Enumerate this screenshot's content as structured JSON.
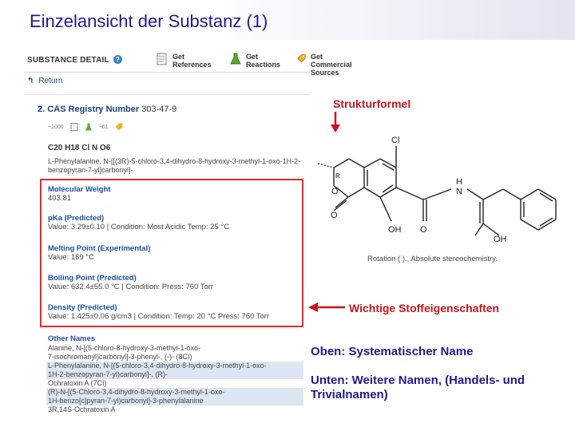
{
  "slide": {
    "title": "Einzelansicht der Substanz (1)"
  },
  "toolbar": {
    "title": "SUBSTANCE DETAIL",
    "help": "?",
    "get_references": [
      "Get",
      "References"
    ],
    "get_reactions": [
      "Get",
      "Reactions"
    ],
    "get_commercial": [
      "Get Commercial",
      "Sources"
    ]
  },
  "nav": {
    "return_label": "Return"
  },
  "substance": {
    "index": "2.",
    "reg_label": "CAS Registry Number",
    "reg_number": "303-47-9",
    "mini_1": "~1000",
    "mini_2": "~61",
    "formula": "C20 H18 Cl N O6",
    "systematic_name": "L-Phenylalanine, N-[[(3R)-5-chloro-3,4-dihydro-8-hydroxy-3-methyl-1-oxo-1H-2-benzopyran-7-yl]carbonyl]-"
  },
  "properties": [
    {
      "label": "Molecular Weight",
      "value": "403.81"
    },
    {
      "label": "pKa (Predicted)",
      "value": "Value: 3.29±0.10 | Condition: Most Acidic Temp: 25 °C"
    },
    {
      "label": "Melting Point (Experimental)",
      "value": "Value: 169 °C"
    },
    {
      "label": "Boiling Point (Predicted)",
      "value": "Value: 632.4±55.0 °C | Condition: Press: 760 Torr"
    },
    {
      "label": "Density (Predicted)",
      "value": "Value: 1.425±0.06 g/cm3 | Condition: Temp: 20 °C Press: 760 Torr"
    }
  ],
  "other_names": {
    "heading": "Other Names",
    "rows": [
      "Alanine, N-[(5-chloro-8-hydroxy-3-methyl-1-oxo-",
      "7-isochromanyl)carbonyl]-3-phenyl-, (-)- (8CI)",
      "L-Phenylalanine, N-[(5-chloro-3,4-dihydro-8-hydroxy-3-methyl-1-oxo-",
      "1H-2-benzopyran-7-yl)carbonyl]-, (R)-",
      "Ochratoxin A (7CI)",
      "(R)-N-[(5-Chloro-3,4-dihydro-8-hydroxy-3-methyl-1-oxo-",
      "1H-benzo[c]pyran-7-yl)carbonyl]-3-phenylalanine",
      "3R,14S-Ochratoxin A"
    ]
  },
  "structure": {
    "atoms": {
      "cl": "Cl",
      "o1": "O",
      "oh1": "OH",
      "o2": "O",
      "nh_n": "N",
      "nh_h": "H",
      "o3": "O",
      "oh2": "OH",
      "r": "R"
    },
    "rotation_text": "Rotation ( )., Absolute stereochemistry."
  },
  "annotations": {
    "strukturformel": "Strukturformel",
    "wichtige": "Wichtige Stoffeigenschaften",
    "oben": "Oben: Systematischer Name",
    "unten": "Unten: Weitere Namen, (Handels- und Trivialnamen)"
  },
  "colors": {
    "title": "#1f1a8a",
    "highlight": "#e8282c",
    "link": "#1a4f9c"
  }
}
